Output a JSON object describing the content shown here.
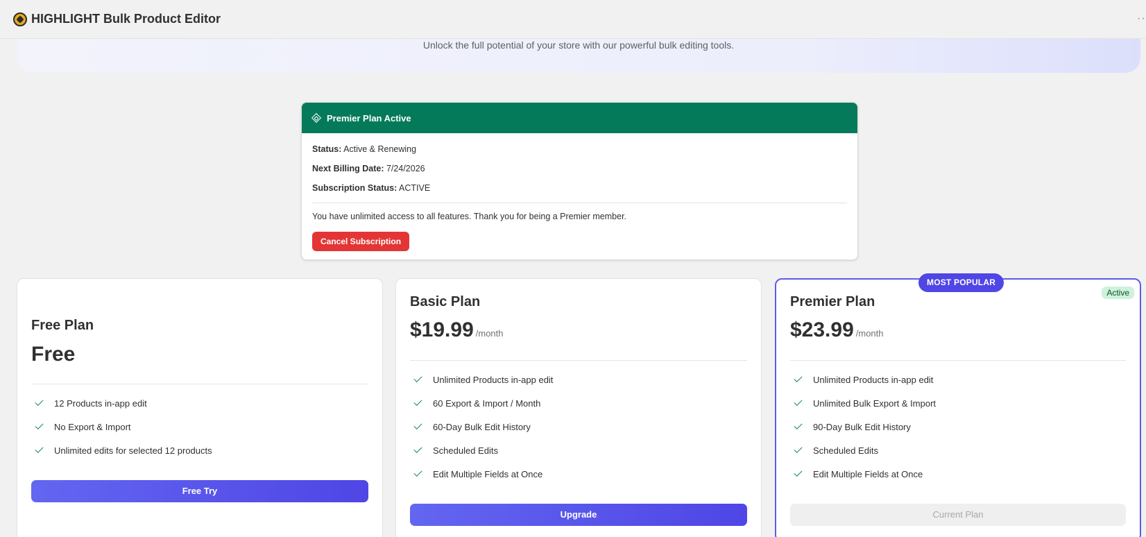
{
  "app": {
    "title": "HIGHLIGHT Bulk Product Editor",
    "more_icon": "more-horizontal-icon",
    "more_label": "···"
  },
  "hero": {
    "subtitle": "Unlock the full potential of your store with our powerful bulk editing tools."
  },
  "subscription": {
    "header": "Premier Plan Active",
    "header_icon": "diamond-icon",
    "header_color": "#057a5a",
    "status_label": "Status:",
    "status_value": "Active & Renewing",
    "billing_label": "Next Billing Date:",
    "billing_value": "7/24/2026",
    "sub_status_label": "Subscription Status:",
    "sub_status_value": "ACTIVE",
    "note": "You have unlimited access to all features. Thank you for being a Premier member.",
    "cancel_label": "Cancel Subscription",
    "cancel_color": "#e33535"
  },
  "plans": [
    {
      "name": "Free Plan",
      "price": "Free",
      "features": [
        "12 Products in-app edit",
        "No Export & Import",
        "Unlimited edits for selected 12 products"
      ],
      "button": "Free Try"
    },
    {
      "name": "Basic Plan",
      "price": "$19.99",
      "period": "/month",
      "features": [
        "Unlimited Products in-app edit",
        "60 Export & Import / Month",
        "60-Day Bulk Edit History",
        "Scheduled Edits",
        "Edit Multiple Fields at Once"
      ],
      "button": "Upgrade"
    },
    {
      "name": "Premier Plan",
      "price": "$23.99",
      "period": "/month",
      "badge": "MOST POPULAR",
      "active_badge": "Active",
      "features": [
        "Unlimited Products in-app edit",
        "Unlimited Bulk Export & Import",
        "90-Day Bulk Edit History",
        "Scheduled Edits",
        "Edit Multiple Fields at Once"
      ],
      "button": "Current Plan"
    }
  ],
  "colors": {
    "accent": "#4f46e5",
    "check": "#0f8a5f",
    "active_badge_bg": "#cdf2d9"
  }
}
